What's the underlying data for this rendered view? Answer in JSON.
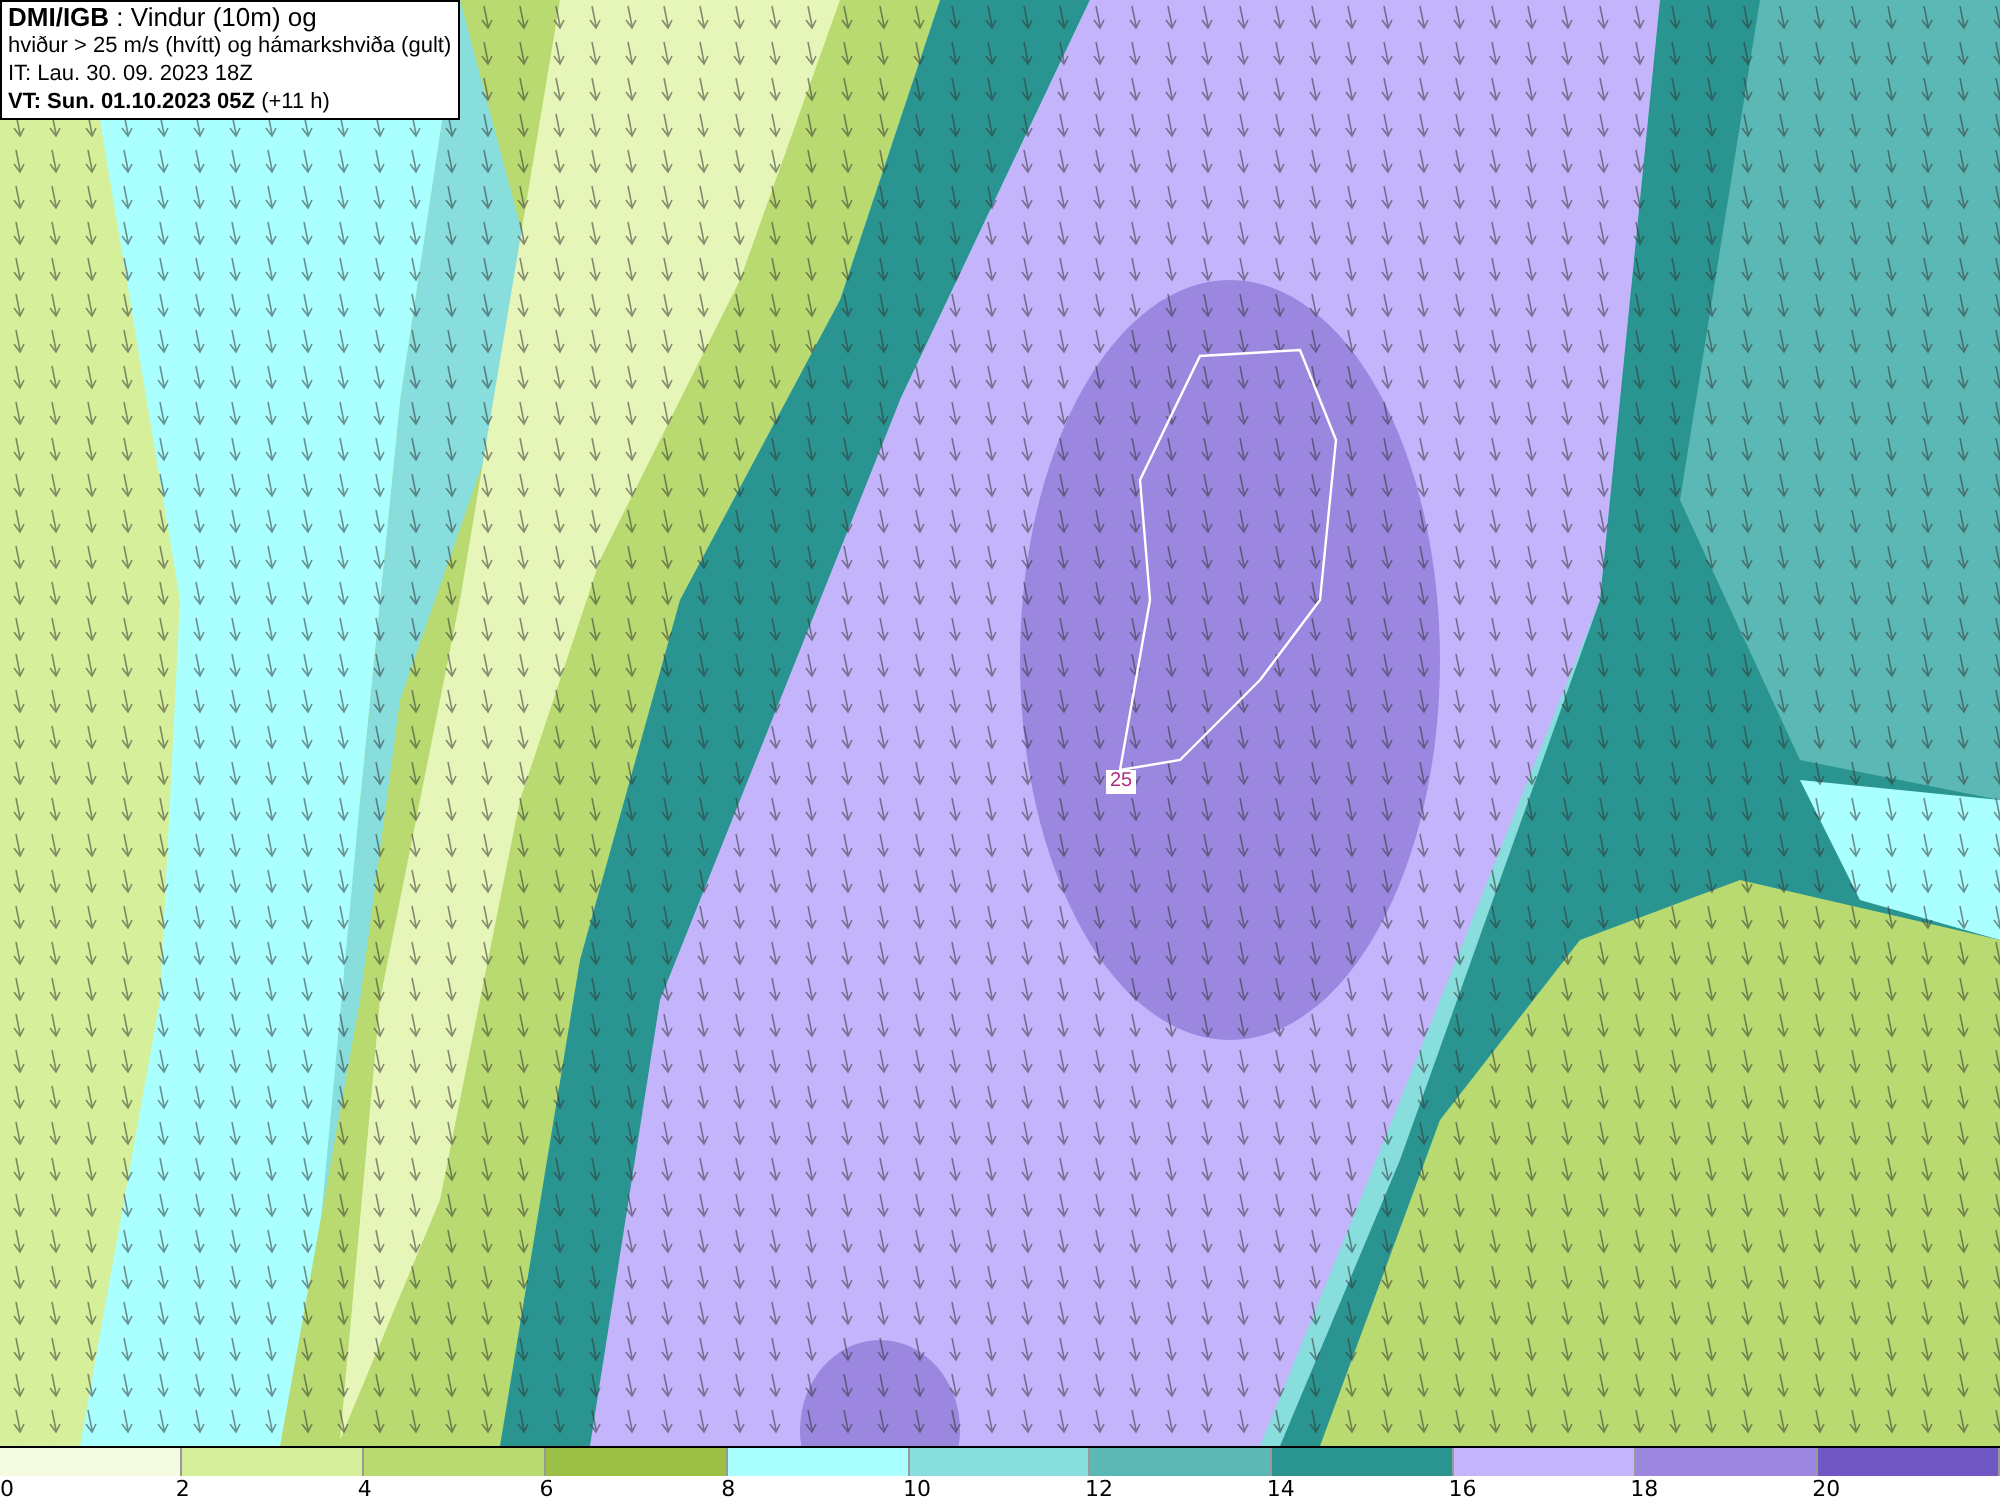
{
  "map": {
    "contour_label": "25"
  },
  "info_box": {
    "lines": [
      "**DMI/IGB** : Vindur (10m) og",
      "hviður > 25 m/s (hvítt) og hámarkshviða (gult)",
      "IT: Lau. 30. 09. 2023 18Z",
      "**VT: Sun. 01.10.2023 05Z** (+11 h)"
    ]
  },
  "legend": {
    "bins": [
      {
        "color": "#f5fbe0",
        "label": "0"
      },
      {
        "color": "#d6ef9a",
        "label": "2"
      },
      {
        "color": "#b8da70",
        "label": "4"
      },
      {
        "color": "#9cc046",
        "label": "6"
      },
      {
        "color": "#aaffff",
        "label": "8"
      },
      {
        "color": "#88dddd",
        "label": "10"
      },
      {
        "color": "#5cb8b4",
        "label": "12"
      },
      {
        "color": "#2a9490",
        "label": "14"
      },
      {
        "color": "#c4b4fc",
        "label": "16"
      },
      {
        "color": "#9b87e0",
        "label": "18"
      },
      {
        "color": "#7058c4",
        "label": "20"
      }
    ]
  }
}
